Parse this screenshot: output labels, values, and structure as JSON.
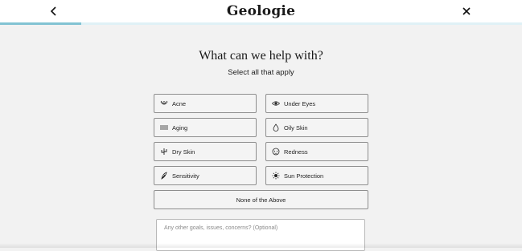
{
  "header": {
    "logo": "Geologie",
    "back_icon": "chevron-left-icon",
    "close_icon": "close-icon"
  },
  "progress": {
    "fraction": 0.156,
    "fill_color": "#82c3d3"
  },
  "question": {
    "title": "What can we help with?",
    "subtitle": "Select all that apply"
  },
  "options": [
    {
      "label": "Acne",
      "icon": "acne-icon"
    },
    {
      "label": "Under Eyes",
      "icon": "eye-icon"
    },
    {
      "label": "Aging",
      "icon": "aging-lines-icon"
    },
    {
      "label": "Oily Skin",
      "icon": "oil-drop-icon"
    },
    {
      "label": "Dry Skin",
      "icon": "cactus-icon"
    },
    {
      "label": "Redness",
      "icon": "face-icon"
    },
    {
      "label": "Sensitivity",
      "icon": "feather-icon"
    },
    {
      "label": "Sun Protection",
      "icon": "sun-icon"
    }
  ],
  "none_option": {
    "label": "None of the Above"
  },
  "other_input": {
    "placeholder": "Any other goals, issues, concerns? (Optional)"
  }
}
